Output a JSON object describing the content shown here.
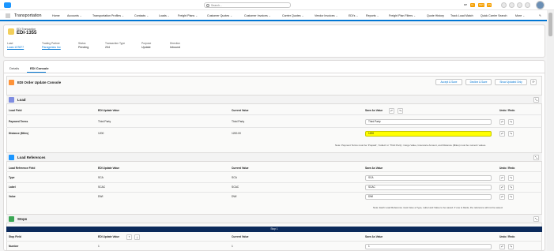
{
  "header": {
    "search_placeholder": "Search...",
    "badges": [
      "DP",
      "CL",
      "DEV",
      "US"
    ],
    "icons": [
      "add-icon",
      "setup-icon",
      "help-icon",
      "gear-icon",
      "bell-icon"
    ]
  },
  "nav": {
    "app_name": "Transportation",
    "items": [
      "Home",
      "Accounts",
      "Transportation Profiles",
      "Contacts",
      "Loads",
      "Freight Plans",
      "Customer Quotes",
      "Customer Invoices",
      "Carrier Quotes",
      "Vendor Invoices",
      "EDI's",
      "Reports",
      "Freight Plan Filters",
      "Quote History",
      "Track Load Match",
      "Quick Carrier Search",
      "More"
    ]
  },
  "record": {
    "type_label": "EDI Transaction",
    "name": "EDI-1355",
    "fields": [
      {
        "label": "Load",
        "value": "Load-137877",
        "link": true
      },
      {
        "label": "Trading Partner",
        "value": "Paragonics Inc",
        "link": true
      },
      {
        "label": "Status",
        "value": "Pending",
        "link": false
      },
      {
        "label": "Transaction Type",
        "value": "204",
        "link": false
      },
      {
        "label": "Purpose",
        "value": "Update",
        "link": false
      },
      {
        "label": "Direction",
        "value": "Inbound",
        "link": false
      }
    ]
  },
  "tabs": [
    "Details",
    "EDI Console"
  ],
  "console": {
    "title": "EDI Order Update Console",
    "buttons": [
      "Accept & Save",
      "Decline & Save",
      "Show Updated Only"
    ],
    "load": {
      "title": "Load",
      "headers": [
        "Load Field",
        "EDI Update Value",
        "Current Value",
        "Save As Value",
        "Undo / Redo"
      ],
      "rows": [
        {
          "field": "Payment Terms",
          "edi": "Third Party",
          "current": "Third Party",
          "save": "Third Party"
        },
        {
          "field": "Distance (Miles)",
          "edi": "1200",
          "current": "1200.00",
          "save": "1200"
        }
      ],
      "note": "Note: Payment Terms must be 'Prepaid', 'Collect' or 'Third Party'. Cargo Value, Insurance Amount, and Distance (Miles) must be numeric values."
    },
    "refs": {
      "title": "Load References",
      "headers": [
        "Load Reference Field",
        "EDI Update Value",
        "Current Value",
        "Save As Value",
        "Undo / Redo"
      ],
      "rows": [
        {
          "field": "Type",
          "edi": "SCA",
          "current": "SCA",
          "save": "SCA"
        },
        {
          "field": "Label",
          "edi": "SCAC",
          "current": "SCAC",
          "save": "SCAC"
        },
        {
          "field": "Value",
          "edi": "DWI",
          "current": "DWI",
          "save": "DWI"
        }
      ],
      "note": "Note: Each Load Reference must have a Type, Label and Value to be saved. If one is blank, the reference will not be saved."
    },
    "stops": {
      "title": "Stops",
      "bar": "Stop 1",
      "headers": [
        "Stop Field",
        "EDI Update Value",
        "Current Value",
        "Save As Value",
        "Undo / Redo"
      ],
      "rows": [
        {
          "field": "Number",
          "edi": "1",
          "current": "1",
          "save": "1"
        }
      ]
    }
  }
}
